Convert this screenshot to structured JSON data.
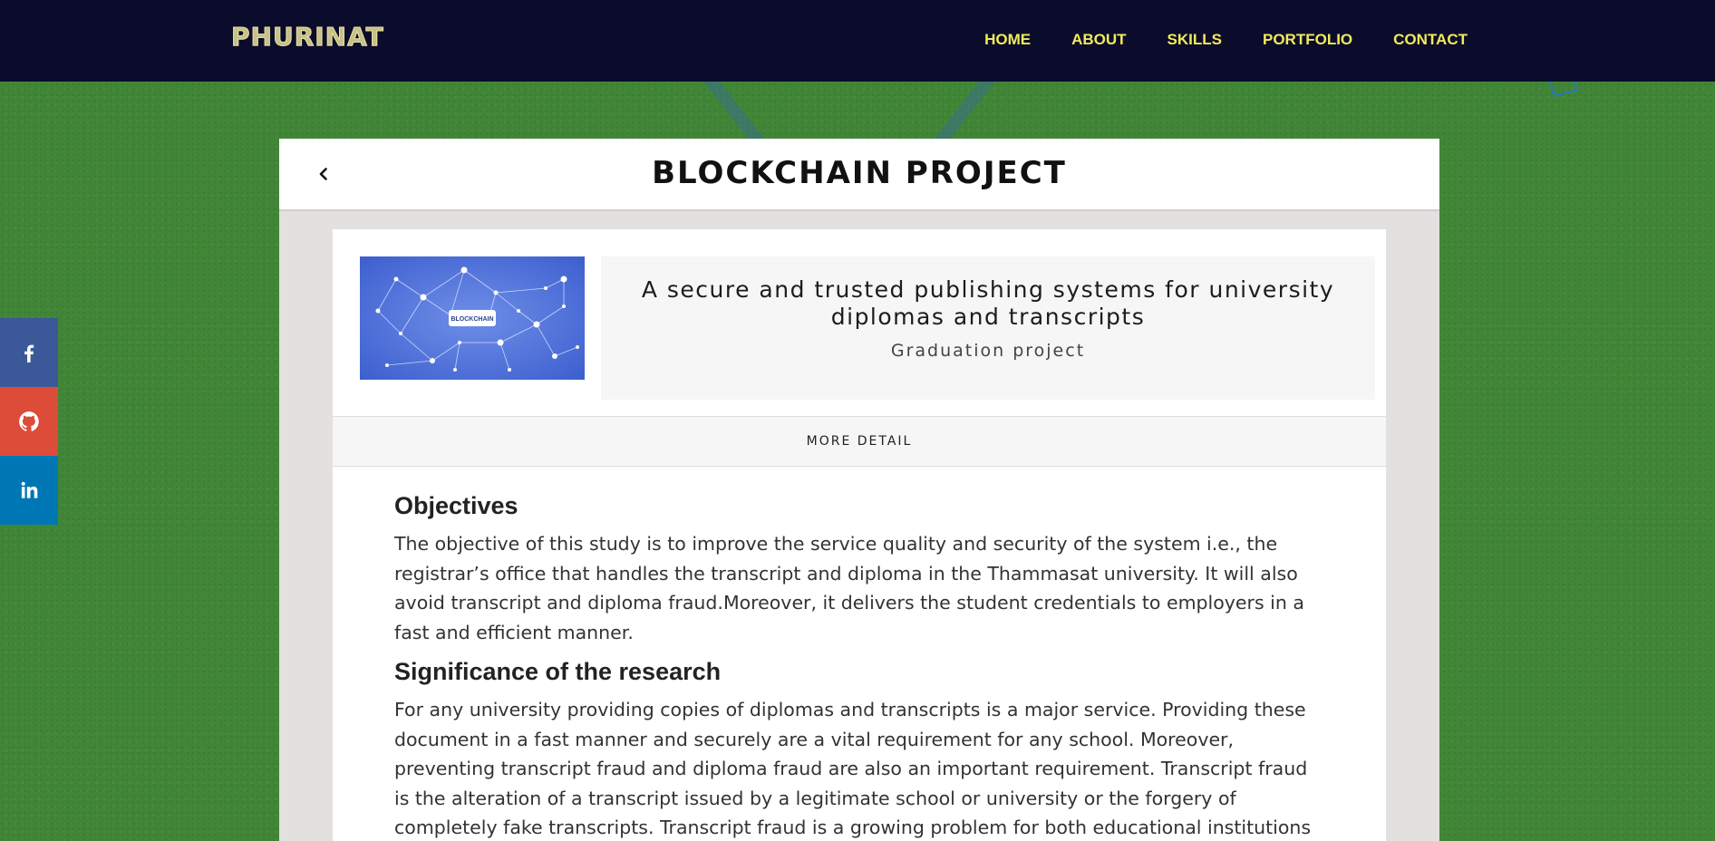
{
  "nav": {
    "logo": "PHURINAT",
    "links": [
      "HOME",
      "ABOUT",
      "SKILLS",
      "PORTFOLIO",
      "CONTACT"
    ]
  },
  "social": {
    "facebook_color": "#3b5998",
    "github_color": "#dd4b39",
    "linkedin_color": "#0077b5"
  },
  "panel": {
    "title": "BLOCKCHAIN PROJECT"
  },
  "project": {
    "thumbnail_label": "BLOCKCHAIN",
    "title": "A secure and trusted publishing systems for university diplomas and transcripts",
    "subtitle": "Graduation project",
    "more_detail_label": "MORE DETAIL"
  },
  "sections": [
    {
      "heading": "Objectives",
      "body": "The objective of this study is to improve the service quality and security of the system i.e., the registrar’s office that handles the transcript and diploma in the Thammasat university. It will also avoid transcript and diploma fraud.Moreover, it delivers the student credentials to employers in a fast and efficient manner."
    },
    {
      "heading": "Significance of the research",
      "body": "For any university providing copies of diplomas and transcripts is a major service. Providing these document in a fast manner and securely are a vital requirement for any school. Moreover, preventing transcript fraud and diploma fraud are also an important requirement. Transcript fraud is the alteration of a transcript issued by a legitimate school or university or the forgery of completely fake transcripts. Transcript fraud is a growing problem for both educational institutions"
    }
  ],
  "colors": {
    "navbar": "#0b0c2b",
    "nav_link": "#f2ea5c",
    "background": "#418637",
    "thumbnail_bg": "#4a6fd8"
  }
}
